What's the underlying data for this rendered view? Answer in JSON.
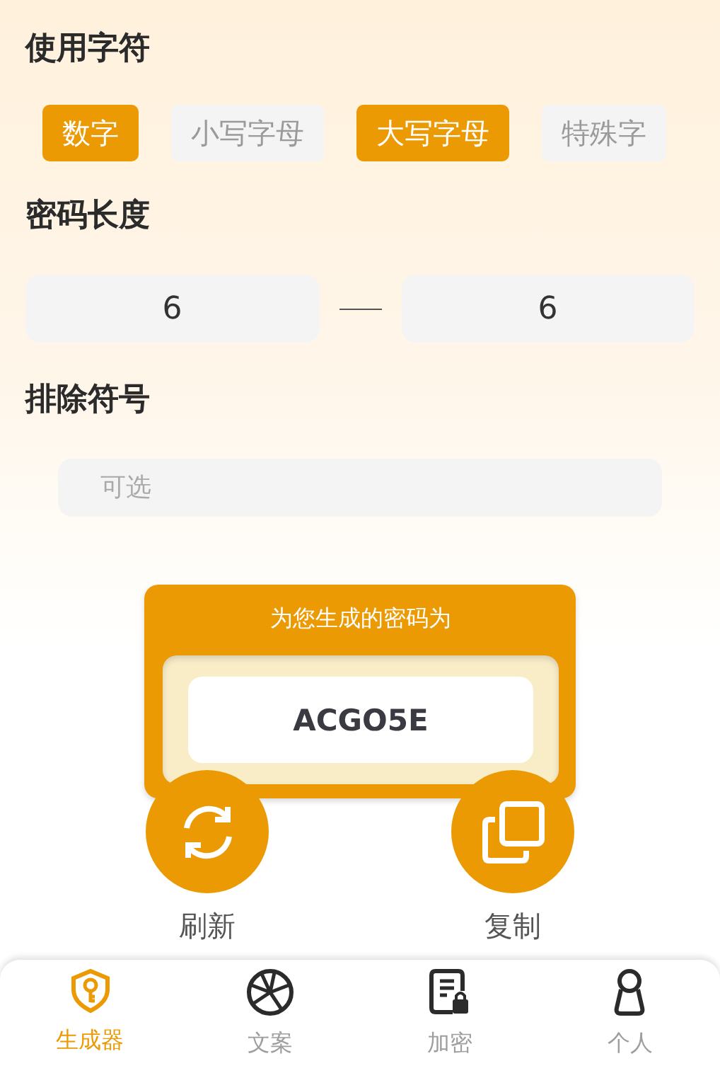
{
  "character_types": {
    "title": "使用字符",
    "options": [
      {
        "label": "数字",
        "selected": true
      },
      {
        "label": "小写字母",
        "selected": false
      },
      {
        "label": "大写字母",
        "selected": true
      },
      {
        "label": "特殊字",
        "selected": false
      }
    ]
  },
  "length": {
    "title": "密码长度",
    "min": "6",
    "max": "6"
  },
  "exclude": {
    "title": "排除符号",
    "placeholder": "可选"
  },
  "result": {
    "title": "为您生成的密码为",
    "password": "ACGO5E"
  },
  "actions": [
    {
      "kind": "refresh",
      "label": "刷新"
    },
    {
      "kind": "copy",
      "label": "复制"
    }
  ],
  "tabs": [
    {
      "kind": "generator",
      "label": "生成器",
      "selected": true
    },
    {
      "kind": "copywriting",
      "label": "文案",
      "selected": false
    },
    {
      "kind": "encrypt",
      "label": "加密",
      "selected": false
    },
    {
      "kind": "profile",
      "label": "个人",
      "selected": false
    }
  ]
}
